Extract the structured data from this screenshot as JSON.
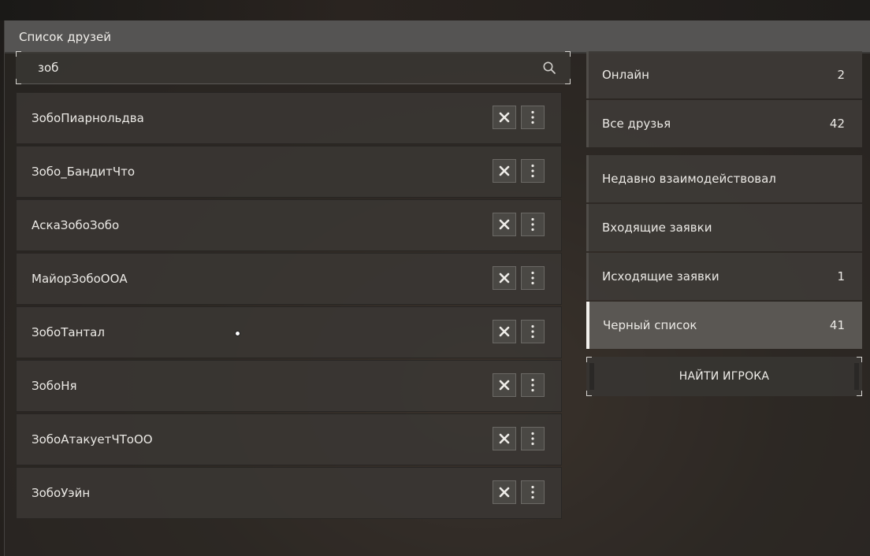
{
  "window": {
    "title": "Список друзей"
  },
  "search": {
    "value": "зоб",
    "icon": "search-icon"
  },
  "friends": [
    {
      "name": "ЗобоПиарнольдва"
    },
    {
      "name": "Зобо_БандитЧто"
    },
    {
      "name": "АскаЗобоЗобо"
    },
    {
      "name": "МайорЗобоООА"
    },
    {
      "name": "ЗобоТантал"
    },
    {
      "name": "ЗобоНя"
    },
    {
      "name": "ЗобоАтакуетЧТоОО"
    },
    {
      "name": "ЗобоУэйн"
    }
  ],
  "row_actions": {
    "remove_icon": "close-icon",
    "more_icon": "more-vertical-icon"
  },
  "tabs": [
    {
      "label": "Онлайн",
      "count": "2"
    },
    {
      "label": "Все друзья",
      "count": "42"
    },
    {
      "label": "Недавно взаимодействовал",
      "count": ""
    },
    {
      "label": "Входящие заявки",
      "count": ""
    },
    {
      "label": "Исходящие заявки",
      "count": "1"
    },
    {
      "label": "Черный список",
      "count": "41",
      "active": true
    }
  ],
  "find_player": {
    "label": "НАЙТИ ИГРОКА"
  },
  "colors": {
    "accent": "#f2f0ec",
    "active_tab": "#5a5753",
    "row_bg": "#3a3733"
  }
}
